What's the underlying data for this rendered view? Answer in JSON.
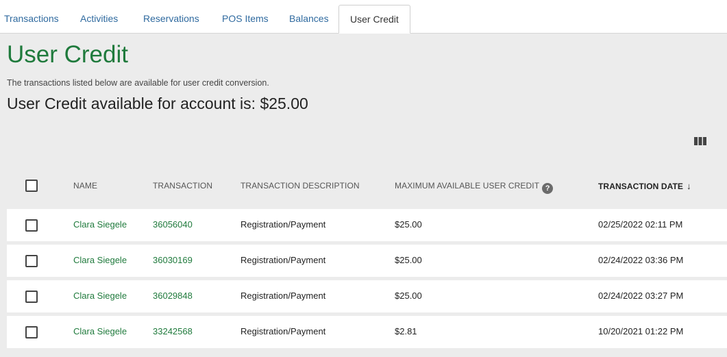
{
  "tabs": [
    {
      "label": "Transactions"
    },
    {
      "label": "Activities"
    },
    {
      "label": "Reservations"
    },
    {
      "label": "POS Items"
    },
    {
      "label": "Balances"
    },
    {
      "label": "User Credit"
    }
  ],
  "header": {
    "title": "User Credit",
    "subtitle": "The transactions listed below are available for user credit conversion.",
    "credit_available": "User Credit available for account is: $25.00"
  },
  "table": {
    "columns": [
      "NAME",
      "TRANSACTION",
      "TRANSACTION DESCRIPTION",
      "MAXIMUM AVAILABLE USER CREDIT",
      "TRANSACTION DATE"
    ],
    "rows": [
      {
        "name": "Clara Siegele",
        "transaction": "36056040",
        "description": "Registration/Payment",
        "credit": "$25.00",
        "date": "02/25/2022 02:11 PM"
      },
      {
        "name": "Clara Siegele",
        "transaction": "36030169",
        "description": "Registration/Payment",
        "credit": "$25.00",
        "date": "02/24/2022 03:36 PM"
      },
      {
        "name": "Clara Siegele",
        "transaction": "36029848",
        "description": "Registration/Payment",
        "credit": "$25.00",
        "date": "02/24/2022 03:27 PM"
      },
      {
        "name": "Clara Siegele",
        "transaction": "33242568",
        "description": "Registration/Payment",
        "credit": "$2.81",
        "date": "10/20/2021 01:22 PM"
      }
    ]
  },
  "icons": {
    "columns": "columns-icon",
    "help": "help-icon",
    "sort": "sort-descending-icon"
  },
  "colors": {
    "accent_green": "#1f7a3c",
    "tab_link": "#2f6a9f",
    "background": "#ececec"
  }
}
